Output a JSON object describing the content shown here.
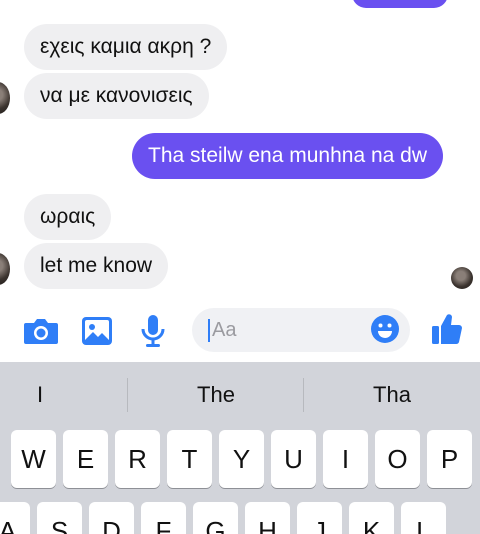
{
  "messages": [
    {
      "direction": "in",
      "text": "εχεις καμια ακρη ?"
    },
    {
      "direction": "in",
      "text": "να με κανονισεις"
    },
    {
      "direction": "out",
      "text": "Tha steilw ena munhna na dw"
    },
    {
      "direction": "in",
      "text": "ωραις"
    },
    {
      "direction": "in",
      "text": "let me know"
    }
  ],
  "composer": {
    "icons": [
      "camera-icon",
      "photo-icon",
      "microphone-icon",
      "emoji-icon",
      "thumbs-up-icon"
    ],
    "placeholder": "Aa",
    "accent": "#2f7ef7"
  },
  "keyboard": {
    "suggestions": [
      "I",
      "The",
      "Tha"
    ],
    "row1": [
      "W",
      "E",
      "R",
      "T",
      "Y",
      "U",
      "I",
      "O",
      "P"
    ],
    "row2": [
      "A",
      "S",
      "D",
      "F",
      "G",
      "H",
      "J",
      "K",
      "L"
    ]
  },
  "colors": {
    "outgoing_bubble": "#6a50f0",
    "incoming_bubble": "#efeff1",
    "keyboard_bg": "#d2d4da"
  }
}
